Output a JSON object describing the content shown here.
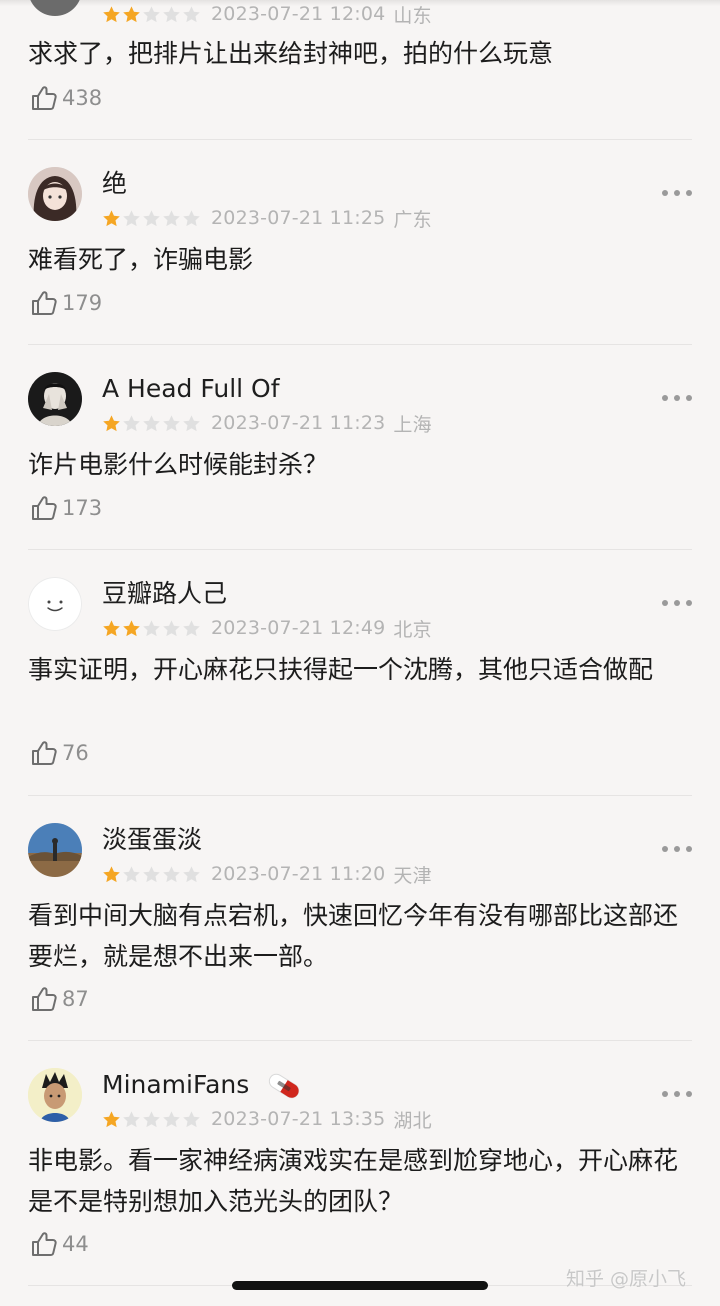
{
  "comments": [
    {
      "username": "",
      "rating": 2,
      "date": "2023-07-21 12:04",
      "location": "山东",
      "text": "求求了，把排片让出来给封神吧，拍的什么玩意",
      "likes": "438"
    },
    {
      "username": "绝",
      "rating": 1,
      "date": "2023-07-21 11:25",
      "location": "广东",
      "text": "难看死了，诈骗电影",
      "likes": "179"
    },
    {
      "username": "A Head Full Of",
      "rating": 1,
      "date": "2023-07-21 11:23",
      "location": "上海",
      "text": "诈片电影什么时候能封杀？",
      "likes": "173"
    },
    {
      "username": "豆瓣路人己",
      "rating": 2,
      "date": "2023-07-21 12:49",
      "location": "北京",
      "text": "事实证明，开心麻花只扶得起一个沈腾，其他只适合做配",
      "likes": "76"
    },
    {
      "username": "淡蛋蛋淡",
      "rating": 1,
      "date": "2023-07-21 11:20",
      "location": "天津",
      "text": "看到中间大脑有点宕机，快速回忆今年有没有哪部比这部还要烂，就是想不出来一部。",
      "likes": "87"
    },
    {
      "username": "MinamiFans",
      "rating": 1,
      "date": "2023-07-21 13:35",
      "location": "湖北",
      "text": "非电影。看一家神经病演戏实在是感到尬穿地心，开心麻花是不是特别想加入范光头的团队？",
      "likes": "44"
    }
  ],
  "colors": {
    "background": "#f7f5f4",
    "star_filled": "#f5a623",
    "star_empty": "#e0e0e0",
    "meta_text": "#b4b4b4"
  },
  "icons": {
    "like": "thumbs-up-icon",
    "more": "more-dots-icon",
    "badge": "pill-badge-icon"
  },
  "watermark": "知乎 @原小飞"
}
